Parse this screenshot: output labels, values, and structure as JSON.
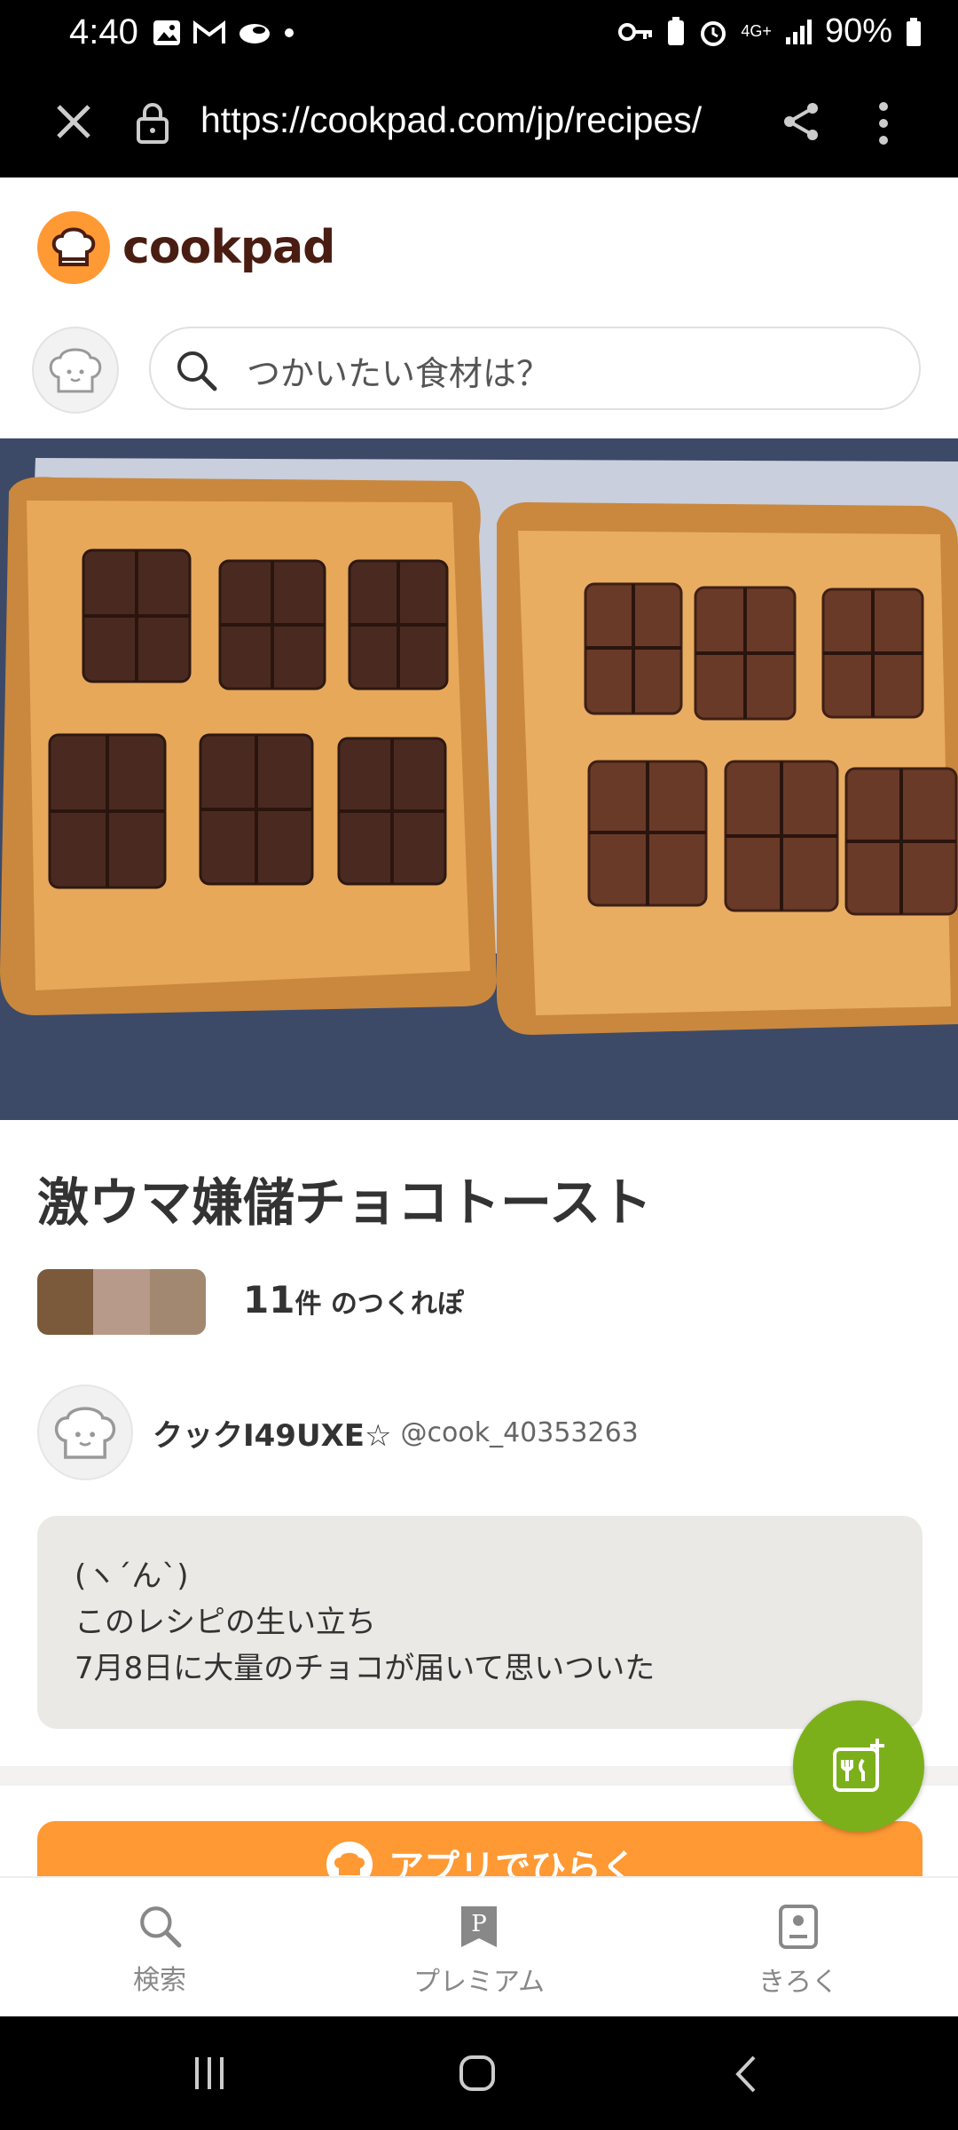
{
  "status_bar": {
    "time": "4:40",
    "battery": "90%",
    "network": "4G+"
  },
  "browser": {
    "url": "https://cookpad.com/jp/recipes/"
  },
  "brand": {
    "name": "cookpad",
    "accent": "#ff9933"
  },
  "search": {
    "placeholder": "つかいたい食材は？"
  },
  "recipe": {
    "title": "激ウマ嫌儲チョコトースト",
    "tsukurepo_count": "11",
    "tsukurepo_unit": "件 のつくれぽ",
    "author_name": "クックI49UXE☆",
    "author_handle": "@cook_40353263",
    "story": [
      "(ヽ´ん`)",
      "このレシピの生い立ち",
      "7月8日に大量のチョコが届いて思いついた"
    ]
  },
  "cta": {
    "open_app": "アプリでひらく"
  },
  "bottom_nav": [
    {
      "label": "検索",
      "icon": "search-icon"
    },
    {
      "label": "プレミアム",
      "icon": "premium-icon"
    },
    {
      "label": "きろく",
      "icon": "record-icon"
    }
  ]
}
